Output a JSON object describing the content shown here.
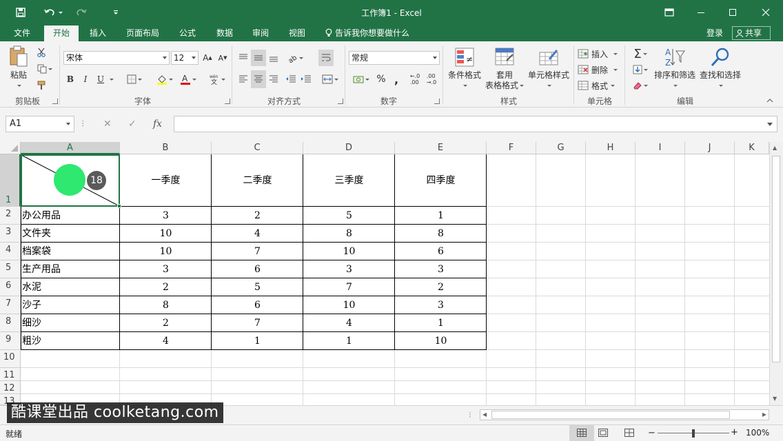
{
  "titlebar": {
    "title": "工作簿1 - Excel",
    "bg_color": "#217346"
  },
  "menu_tabs": [
    {
      "label": "文件"
    },
    {
      "label": "开始",
      "active": true
    },
    {
      "label": "插入"
    },
    {
      "label": "页面布局"
    },
    {
      "label": "公式"
    },
    {
      "label": "数据"
    },
    {
      "label": "审阅"
    },
    {
      "label": "视图"
    }
  ],
  "tell_me": "告诉我你想要做什么",
  "login": "登录",
  "share": "共享",
  "ribbon": {
    "clipboard": {
      "paste": "粘贴",
      "label": "剪贴板"
    },
    "font": {
      "name": "宋体",
      "size": "12",
      "bold": "B",
      "italic": "I",
      "underline": "U",
      "label": "字体"
    },
    "alignment": {
      "label": "对齐方式"
    },
    "number": {
      "format": "常规",
      "label": "数字"
    },
    "styles": {
      "conditional": "条件格式",
      "table": "套用",
      "table2": "表格格式",
      "cell_styles": "单元格样式",
      "label": "样式"
    },
    "cells": {
      "insert": "插入",
      "delete": "删除",
      "format": "格式",
      "label": "单元格"
    },
    "editing": {
      "sort": "排序和筛选",
      "find": "查找和选择",
      "label": "编辑"
    }
  },
  "formula_bar": {
    "name_box": "A1",
    "fx": "fx",
    "value": ""
  },
  "columns": [
    "A",
    "B",
    "C",
    "D",
    "E",
    "F",
    "G",
    "H",
    "I",
    "J",
    "K"
  ],
  "rows": [
    "1",
    "2",
    "3",
    "4",
    "5",
    "6",
    "7",
    "8",
    "9",
    "10",
    "11",
    "12",
    "13"
  ],
  "table": {
    "headers": [
      "一季度",
      "二季度",
      "三季度",
      "四季度"
    ],
    "rows": [
      {
        "label": "办公用品",
        "values": [
          3,
          2,
          5,
          1
        ]
      },
      {
        "label": "文件夹",
        "values": [
          10,
          4,
          8,
          8
        ]
      },
      {
        "label": "档案袋",
        "values": [
          10,
          7,
          10,
          6
        ]
      },
      {
        "label": "生产用品",
        "values": [
          3,
          6,
          3,
          3
        ]
      },
      {
        "label": "水泥",
        "values": [
          2,
          5,
          7,
          2
        ]
      },
      {
        "label": "沙子",
        "values": [
          8,
          6,
          10,
          3
        ]
      },
      {
        "label": "细沙",
        "values": [
          2,
          7,
          4,
          1
        ]
      },
      {
        "label": "粗沙",
        "values": [
          4,
          1,
          1,
          10
        ]
      }
    ]
  },
  "cursor_badge": "18",
  "cursor_color": "#2ee870",
  "status": {
    "ready": "就绪",
    "zoom": "100%"
  },
  "watermark": "酷课堂出品 coolketang.com"
}
